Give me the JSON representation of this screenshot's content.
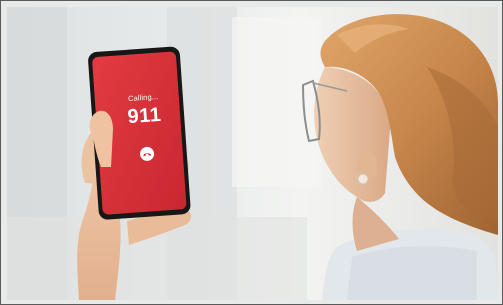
{
  "phone": {
    "call_status": "Calling...",
    "call_number": "911"
  },
  "icons": {
    "end_call": "phone-hangup-icon"
  },
  "colors": {
    "screen_red": "#d5262f",
    "hair": "#c9874a",
    "skin": "#e8bf9f",
    "background": "#e6e8e7"
  }
}
